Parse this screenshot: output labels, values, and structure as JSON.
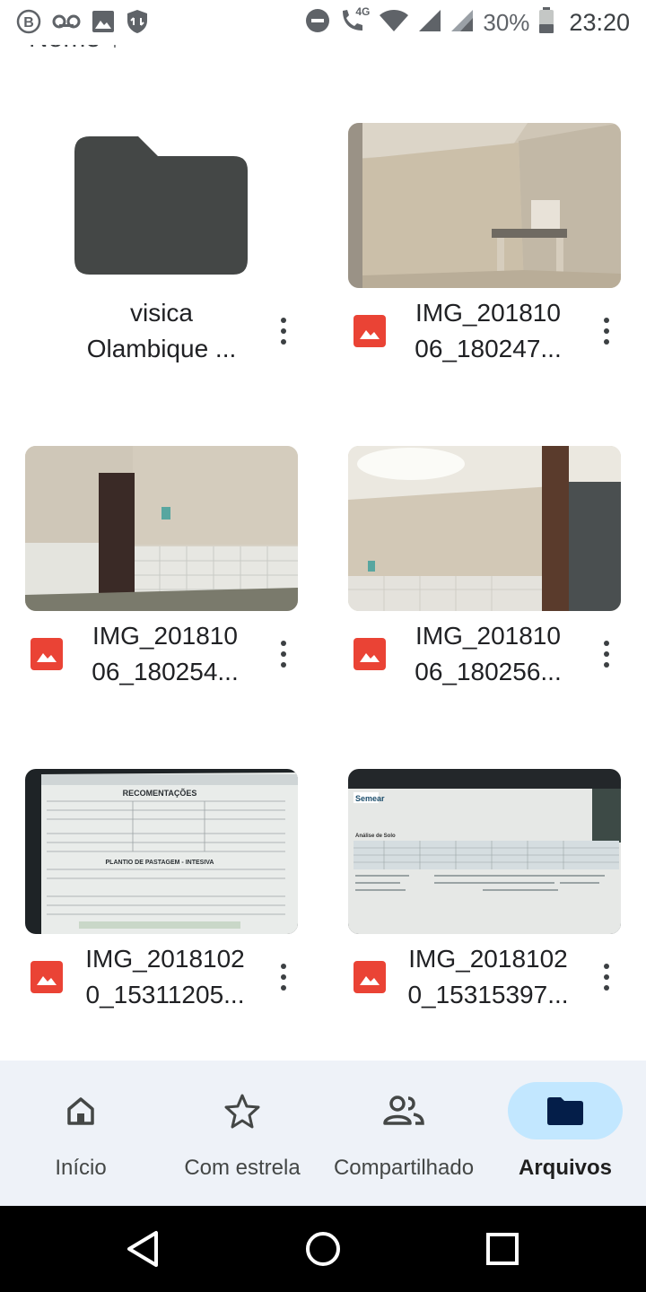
{
  "status_bar": {
    "battery_text": "30%",
    "time": "23:20",
    "network_badge": "4G",
    "icons_left": [
      "b-circle-icon",
      "voicemail-icon",
      "image-icon",
      "vpn-shield-icon"
    ],
    "icons_right": [
      "do-not-disturb-icon",
      "wifi-calling-icon",
      "wifi-icon",
      "signal-icon",
      "signal-icon",
      "battery-icon"
    ]
  },
  "header": {
    "partial_text": "Nome ↑",
    "view_toggle_icon": "list-view-icon"
  },
  "files": [
    {
      "kind": "folder",
      "line1": "visica",
      "line2": "Olambique ...",
      "icon": "folder-icon"
    },
    {
      "kind": "image",
      "line1": "IMG_201810",
      "line2": "06_180247...",
      "icon": "image-file-icon"
    },
    {
      "kind": "image",
      "line1": "IMG_201810",
      "line2": "06_180254...",
      "icon": "image-file-icon"
    },
    {
      "kind": "image",
      "line1": "IMG_201810",
      "line2": "06_180256...",
      "icon": "image-file-icon"
    },
    {
      "kind": "image",
      "line1": "IMG_2018102",
      "line2": "0_15311205...",
      "icon": "image-file-icon"
    },
    {
      "kind": "image",
      "line1": "IMG_2018102",
      "line2": "0_15315397...",
      "icon": "image-file-icon"
    }
  ],
  "thumbnail_text": {
    "sheet_title": "RECOMENTAÇÕES",
    "sheet_section": "PLANTIO DE PASTAGEM - INTESIVA",
    "report_logo": "Semear",
    "report_heading": "Análise de Solo"
  },
  "bottom_nav": {
    "items": [
      {
        "label": "Início",
        "icon": "home-icon",
        "active": false
      },
      {
        "label": "Com estrela",
        "icon": "star-icon",
        "active": false
      },
      {
        "label": "Compartilhado",
        "icon": "shared-people-icon",
        "active": false
      },
      {
        "label": "Arquivos",
        "icon": "folder-icon",
        "active": true
      }
    ]
  },
  "system_nav": {
    "buttons": [
      "back-icon",
      "home-circle-icon",
      "recents-icon"
    ]
  },
  "colors": {
    "accent_pill": "#c2e7ff",
    "image_icon_red": "#ea4335",
    "folder_gray": "#444746",
    "nav_background": "#eef2f8"
  }
}
